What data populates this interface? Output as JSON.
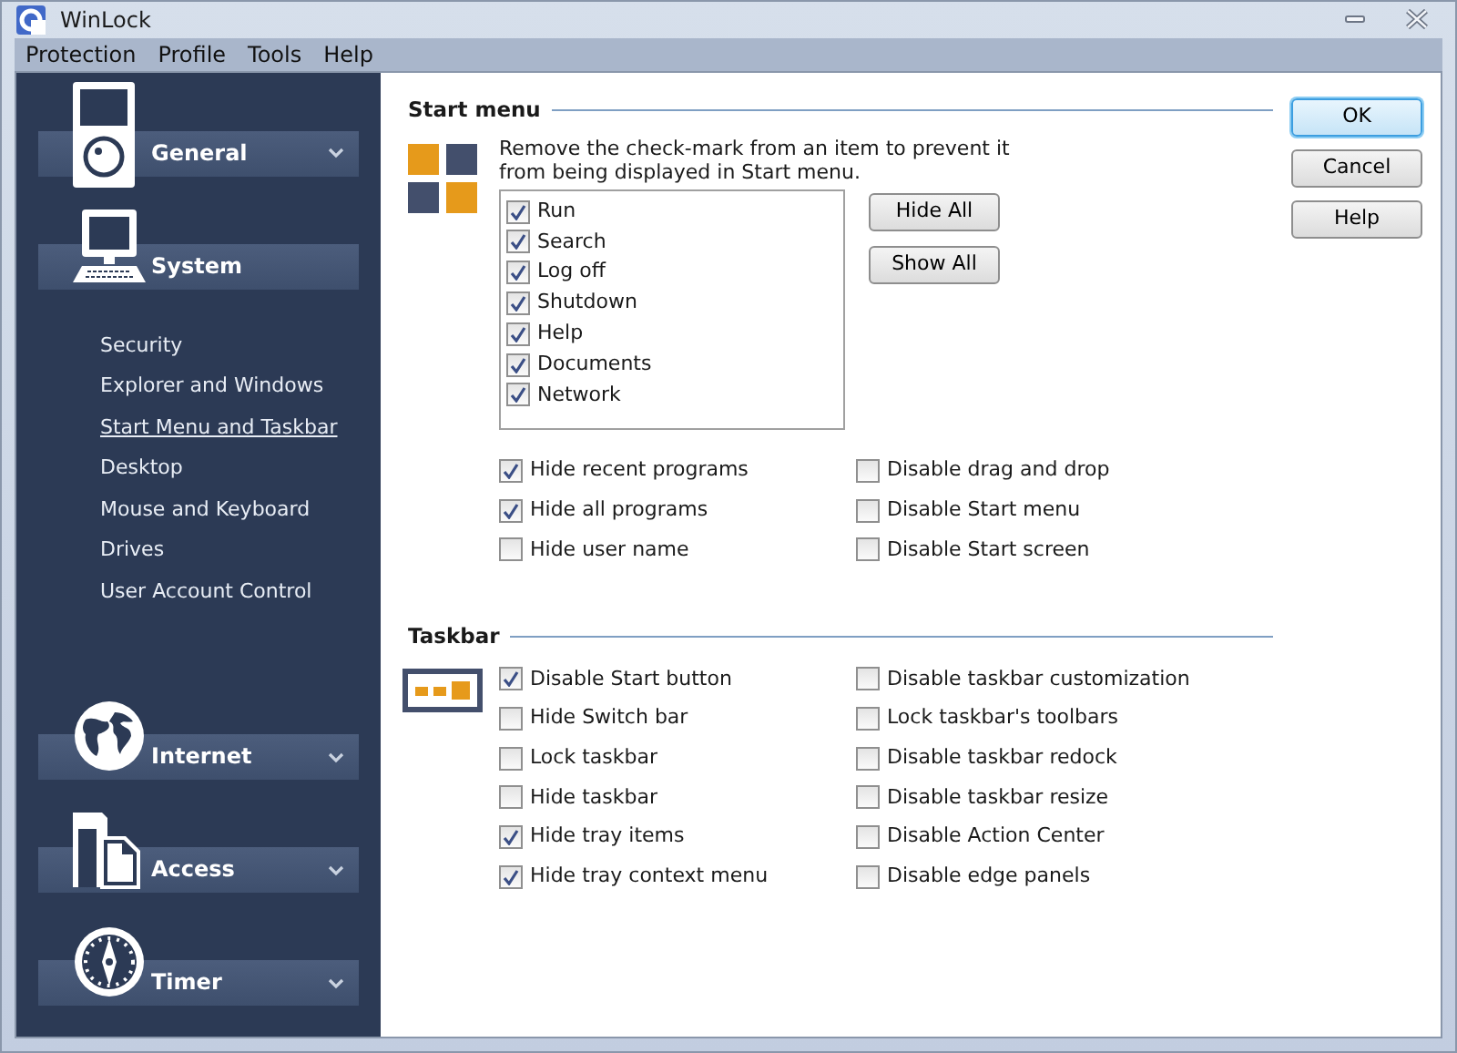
{
  "window": {
    "title": "WinLock"
  },
  "menu": [
    "Protection",
    "Profile",
    "Tools",
    "Help"
  ],
  "sidebar": {
    "categories": [
      {
        "label": "General",
        "expanded": false
      },
      {
        "label": "System",
        "expanded": true,
        "items": [
          {
            "label": "Security",
            "selected": false
          },
          {
            "label": "Explorer and Windows",
            "selected": false
          },
          {
            "label": "Start Menu and Taskbar",
            "selected": true
          },
          {
            "label": "Desktop",
            "selected": false
          },
          {
            "label": "Mouse and Keyboard",
            "selected": false
          },
          {
            "label": "Drives",
            "selected": false
          },
          {
            "label": "User Account Control",
            "selected": false
          }
        ]
      },
      {
        "label": "Internet",
        "expanded": false
      },
      {
        "label": "Access",
        "expanded": false
      },
      {
        "label": "Timer",
        "expanded": false
      }
    ]
  },
  "start_menu": {
    "title": "Start menu",
    "description": "Remove the check-mark from an item to prevent it from being displayed in Start menu.",
    "items": [
      {
        "label": "Run",
        "checked": true
      },
      {
        "label": "Search",
        "checked": true
      },
      {
        "label": "Log off",
        "checked": true
      },
      {
        "label": "Shutdown",
        "checked": true
      },
      {
        "label": "Help",
        "checked": true
      },
      {
        "label": "Documents",
        "checked": true
      },
      {
        "label": "Network",
        "checked": true
      }
    ],
    "buttons": [
      "Hide All",
      "Show All"
    ],
    "options_left": [
      {
        "label": "Hide recent programs",
        "checked": true
      },
      {
        "label": "Hide all programs",
        "checked": true
      },
      {
        "label": "Hide user name",
        "checked": false
      }
    ],
    "options_right": [
      {
        "label": "Disable drag and drop",
        "checked": false
      },
      {
        "label": "Disable Start menu",
        "checked": false
      },
      {
        "label": "Disable Start screen",
        "checked": false
      }
    ]
  },
  "taskbar": {
    "title": "Taskbar",
    "options_left": [
      {
        "label": "Disable Start button",
        "checked": true
      },
      {
        "label": "Hide Switch bar",
        "checked": false
      },
      {
        "label": "Lock taskbar",
        "checked": false
      },
      {
        "label": "Hide taskbar",
        "checked": false
      },
      {
        "label": "Hide tray items",
        "checked": true
      },
      {
        "label": "Hide tray context menu",
        "checked": true
      }
    ],
    "options_right": [
      {
        "label": "Disable taskbar customization",
        "checked": false
      },
      {
        "label": "Lock taskbar's toolbars",
        "checked": false
      },
      {
        "label": "Disable taskbar redock",
        "checked": false
      },
      {
        "label": "Disable taskbar resize",
        "checked": false
      },
      {
        "label": "Disable Action Center",
        "checked": false
      },
      {
        "label": "Disable edge panels",
        "checked": false
      }
    ]
  },
  "dialog_buttons": [
    {
      "label": "OK",
      "default": true
    },
    {
      "label": "Cancel",
      "default": false
    },
    {
      "label": "Help",
      "default": false
    }
  ]
}
